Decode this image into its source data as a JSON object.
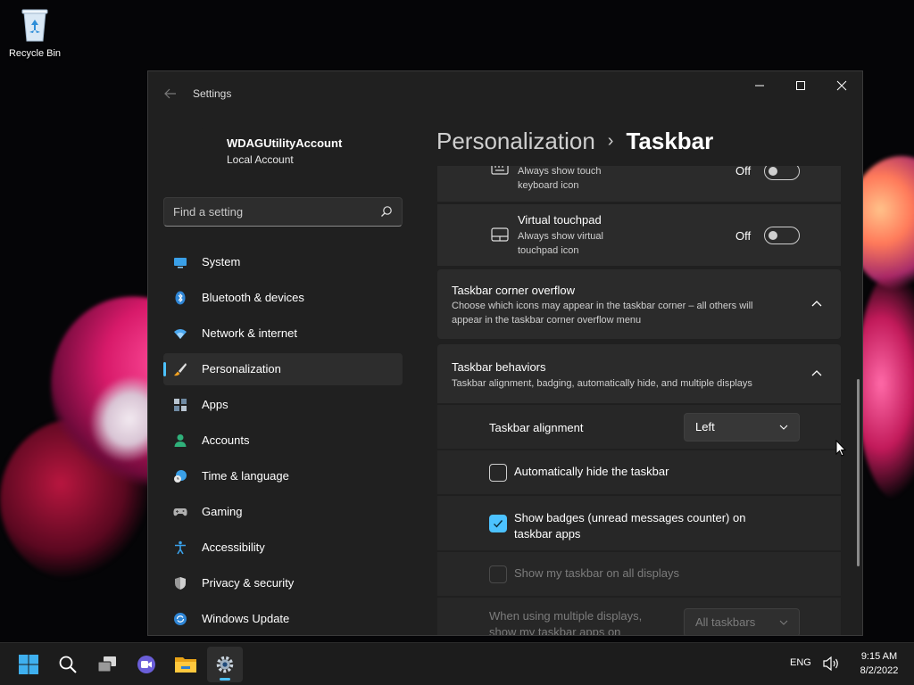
{
  "desktop": {
    "icons": [
      {
        "label": "Recycle Bin",
        "icon": "recycle-bin-icon"
      }
    ]
  },
  "window": {
    "title": "Settings",
    "buttons": {
      "minimize": "minimize",
      "maximize": "maximize",
      "close": "close"
    }
  },
  "profile": {
    "name": "WDAGUtilityAccount",
    "account_type": "Local Account"
  },
  "search": {
    "placeholder": "Find a setting",
    "value": ""
  },
  "sidebar": {
    "items": [
      {
        "label": "System",
        "icon": "monitor-icon",
        "selected": false
      },
      {
        "label": "Bluetooth & devices",
        "icon": "bluetooth-icon",
        "selected": false
      },
      {
        "label": "Network & internet",
        "icon": "wifi-icon",
        "selected": false
      },
      {
        "label": "Personalization",
        "icon": "paintbrush-icon",
        "selected": true
      },
      {
        "label": "Apps",
        "icon": "apps-icon",
        "selected": false
      },
      {
        "label": "Accounts",
        "icon": "person-icon",
        "selected": false
      },
      {
        "label": "Time & language",
        "icon": "globe-clock-icon",
        "selected": false
      },
      {
        "label": "Gaming",
        "icon": "gamepad-icon",
        "selected": false
      },
      {
        "label": "Accessibility",
        "icon": "accessibility-icon",
        "selected": false
      },
      {
        "label": "Privacy & security",
        "icon": "shield-icon",
        "selected": false
      },
      {
        "label": "Windows Update",
        "icon": "update-icon",
        "selected": false
      }
    ]
  },
  "breadcrumb": {
    "parent": "Personalization",
    "separator": "›",
    "current": "Taskbar"
  },
  "content": {
    "touch_keyboard": {
      "desc_line1": "Always show touch",
      "desc_line2": "keyboard icon",
      "state": "Off"
    },
    "virtual_touchpad": {
      "title": "Virtual touchpad",
      "desc_line1": "Always show virtual",
      "desc_line2": "touchpad icon",
      "state": "Off"
    },
    "corner_overflow": {
      "title": "Taskbar corner overflow",
      "desc_line1": "Choose which icons may appear in the taskbar corner – all others will",
      "desc_line2": "appear in the taskbar corner overflow menu"
    },
    "behaviors": {
      "title": "Taskbar behaviors",
      "desc": "Taskbar alignment, badging, automatically hide, and multiple displays",
      "alignment_label": "Taskbar alignment",
      "alignment_value": "Left",
      "auto_hide_label": "Automatically hide the taskbar",
      "auto_hide_checked": false,
      "badges_label_line1": "Show badges (unread messages counter) on",
      "badges_label_line2": "taskbar apps",
      "badges_checked": true,
      "all_displays_label": "Show my taskbar on all displays",
      "all_displays_checked": false,
      "multi_display_label_line1": "When using multiple displays,",
      "multi_display_label_line2": "show my taskbar apps on",
      "multi_display_value": "All taskbars"
    }
  },
  "taskbar": {
    "apps": [
      {
        "name": "start",
        "icon": "windows-start-icon"
      },
      {
        "name": "search",
        "icon": "search-icon"
      },
      {
        "name": "task-view",
        "icon": "task-view-icon"
      },
      {
        "name": "chat",
        "icon": "chat-icon"
      },
      {
        "name": "file-explorer",
        "icon": "folder-icon"
      },
      {
        "name": "settings",
        "icon": "gear-icon",
        "active": true
      }
    ],
    "tray": {
      "language": "ENG",
      "volume_icon": "volume-icon",
      "time": "9:15 AM",
      "date": "8/2/2022"
    }
  },
  "colors": {
    "accent": "#4cc2ff",
    "window_bg": "#202020",
    "card_bg": "#2b2b2b",
    "taskbar_bg": "#1c1c1c"
  }
}
